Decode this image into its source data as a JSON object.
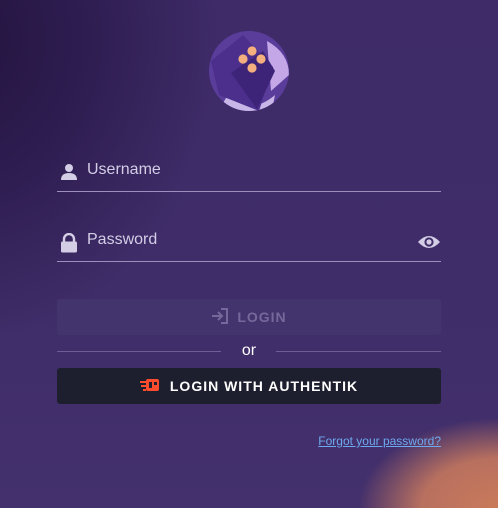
{
  "form": {
    "username_placeholder": "Username",
    "password_placeholder": "Password"
  },
  "buttons": {
    "login_label": "LOGIN",
    "or_label": "or",
    "authentik_label": "LOGIN WITH AUTHENTIK"
  },
  "links": {
    "forgot_password": "Forgot your password?"
  },
  "icons": {
    "username": "user-icon",
    "password": "lock-icon",
    "reveal": "eye-icon",
    "login": "sign-in-icon",
    "authentik": "authentik-icon",
    "logo": "app-logo"
  },
  "colors": {
    "background": "#3c2a66",
    "primary_disabled": "#44346d",
    "auth_button": "#1e1f2e",
    "authentik_brand": "#fd4b2d",
    "link": "#6ea9ef"
  }
}
